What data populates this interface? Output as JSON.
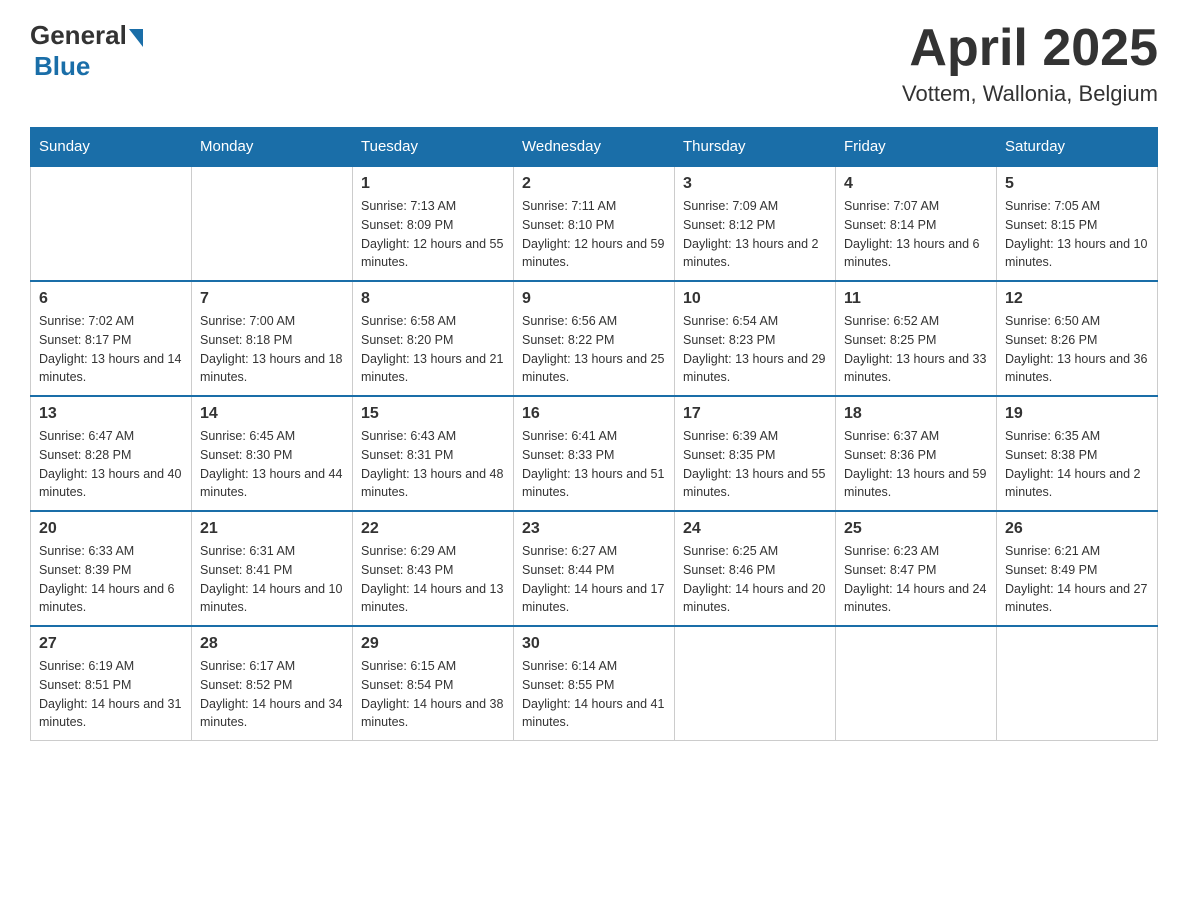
{
  "header": {
    "logo": {
      "general": "General",
      "blue": "Blue"
    },
    "title": "April 2025",
    "location": "Vottem, Wallonia, Belgium"
  },
  "days_of_week": [
    "Sunday",
    "Monday",
    "Tuesday",
    "Wednesday",
    "Thursday",
    "Friday",
    "Saturday"
  ],
  "weeks": [
    [
      {
        "day": "",
        "sunrise": "",
        "sunset": "",
        "daylight": ""
      },
      {
        "day": "",
        "sunrise": "",
        "sunset": "",
        "daylight": ""
      },
      {
        "day": "1",
        "sunrise": "Sunrise: 7:13 AM",
        "sunset": "Sunset: 8:09 PM",
        "daylight": "Daylight: 12 hours and 55 minutes."
      },
      {
        "day": "2",
        "sunrise": "Sunrise: 7:11 AM",
        "sunset": "Sunset: 8:10 PM",
        "daylight": "Daylight: 12 hours and 59 minutes."
      },
      {
        "day": "3",
        "sunrise": "Sunrise: 7:09 AM",
        "sunset": "Sunset: 8:12 PM",
        "daylight": "Daylight: 13 hours and 2 minutes."
      },
      {
        "day": "4",
        "sunrise": "Sunrise: 7:07 AM",
        "sunset": "Sunset: 8:14 PM",
        "daylight": "Daylight: 13 hours and 6 minutes."
      },
      {
        "day": "5",
        "sunrise": "Sunrise: 7:05 AM",
        "sunset": "Sunset: 8:15 PM",
        "daylight": "Daylight: 13 hours and 10 minutes."
      }
    ],
    [
      {
        "day": "6",
        "sunrise": "Sunrise: 7:02 AM",
        "sunset": "Sunset: 8:17 PM",
        "daylight": "Daylight: 13 hours and 14 minutes."
      },
      {
        "day": "7",
        "sunrise": "Sunrise: 7:00 AM",
        "sunset": "Sunset: 8:18 PM",
        "daylight": "Daylight: 13 hours and 18 minutes."
      },
      {
        "day": "8",
        "sunrise": "Sunrise: 6:58 AM",
        "sunset": "Sunset: 8:20 PM",
        "daylight": "Daylight: 13 hours and 21 minutes."
      },
      {
        "day": "9",
        "sunrise": "Sunrise: 6:56 AM",
        "sunset": "Sunset: 8:22 PM",
        "daylight": "Daylight: 13 hours and 25 minutes."
      },
      {
        "day": "10",
        "sunrise": "Sunrise: 6:54 AM",
        "sunset": "Sunset: 8:23 PM",
        "daylight": "Daylight: 13 hours and 29 minutes."
      },
      {
        "day": "11",
        "sunrise": "Sunrise: 6:52 AM",
        "sunset": "Sunset: 8:25 PM",
        "daylight": "Daylight: 13 hours and 33 minutes."
      },
      {
        "day": "12",
        "sunrise": "Sunrise: 6:50 AM",
        "sunset": "Sunset: 8:26 PM",
        "daylight": "Daylight: 13 hours and 36 minutes."
      }
    ],
    [
      {
        "day": "13",
        "sunrise": "Sunrise: 6:47 AM",
        "sunset": "Sunset: 8:28 PM",
        "daylight": "Daylight: 13 hours and 40 minutes."
      },
      {
        "day": "14",
        "sunrise": "Sunrise: 6:45 AM",
        "sunset": "Sunset: 8:30 PM",
        "daylight": "Daylight: 13 hours and 44 minutes."
      },
      {
        "day": "15",
        "sunrise": "Sunrise: 6:43 AM",
        "sunset": "Sunset: 8:31 PM",
        "daylight": "Daylight: 13 hours and 48 minutes."
      },
      {
        "day": "16",
        "sunrise": "Sunrise: 6:41 AM",
        "sunset": "Sunset: 8:33 PM",
        "daylight": "Daylight: 13 hours and 51 minutes."
      },
      {
        "day": "17",
        "sunrise": "Sunrise: 6:39 AM",
        "sunset": "Sunset: 8:35 PM",
        "daylight": "Daylight: 13 hours and 55 minutes."
      },
      {
        "day": "18",
        "sunrise": "Sunrise: 6:37 AM",
        "sunset": "Sunset: 8:36 PM",
        "daylight": "Daylight: 13 hours and 59 minutes."
      },
      {
        "day": "19",
        "sunrise": "Sunrise: 6:35 AM",
        "sunset": "Sunset: 8:38 PM",
        "daylight": "Daylight: 14 hours and 2 minutes."
      }
    ],
    [
      {
        "day": "20",
        "sunrise": "Sunrise: 6:33 AM",
        "sunset": "Sunset: 8:39 PM",
        "daylight": "Daylight: 14 hours and 6 minutes."
      },
      {
        "day": "21",
        "sunrise": "Sunrise: 6:31 AM",
        "sunset": "Sunset: 8:41 PM",
        "daylight": "Daylight: 14 hours and 10 minutes."
      },
      {
        "day": "22",
        "sunrise": "Sunrise: 6:29 AM",
        "sunset": "Sunset: 8:43 PM",
        "daylight": "Daylight: 14 hours and 13 minutes."
      },
      {
        "day": "23",
        "sunrise": "Sunrise: 6:27 AM",
        "sunset": "Sunset: 8:44 PM",
        "daylight": "Daylight: 14 hours and 17 minutes."
      },
      {
        "day": "24",
        "sunrise": "Sunrise: 6:25 AM",
        "sunset": "Sunset: 8:46 PM",
        "daylight": "Daylight: 14 hours and 20 minutes."
      },
      {
        "day": "25",
        "sunrise": "Sunrise: 6:23 AM",
        "sunset": "Sunset: 8:47 PM",
        "daylight": "Daylight: 14 hours and 24 minutes."
      },
      {
        "day": "26",
        "sunrise": "Sunrise: 6:21 AM",
        "sunset": "Sunset: 8:49 PM",
        "daylight": "Daylight: 14 hours and 27 minutes."
      }
    ],
    [
      {
        "day": "27",
        "sunrise": "Sunrise: 6:19 AM",
        "sunset": "Sunset: 8:51 PM",
        "daylight": "Daylight: 14 hours and 31 minutes."
      },
      {
        "day": "28",
        "sunrise": "Sunrise: 6:17 AM",
        "sunset": "Sunset: 8:52 PM",
        "daylight": "Daylight: 14 hours and 34 minutes."
      },
      {
        "day": "29",
        "sunrise": "Sunrise: 6:15 AM",
        "sunset": "Sunset: 8:54 PM",
        "daylight": "Daylight: 14 hours and 38 minutes."
      },
      {
        "day": "30",
        "sunrise": "Sunrise: 6:14 AM",
        "sunset": "Sunset: 8:55 PM",
        "daylight": "Daylight: 14 hours and 41 minutes."
      },
      {
        "day": "",
        "sunrise": "",
        "sunset": "",
        "daylight": ""
      },
      {
        "day": "",
        "sunrise": "",
        "sunset": "",
        "daylight": ""
      },
      {
        "day": "",
        "sunrise": "",
        "sunset": "",
        "daylight": ""
      }
    ]
  ]
}
